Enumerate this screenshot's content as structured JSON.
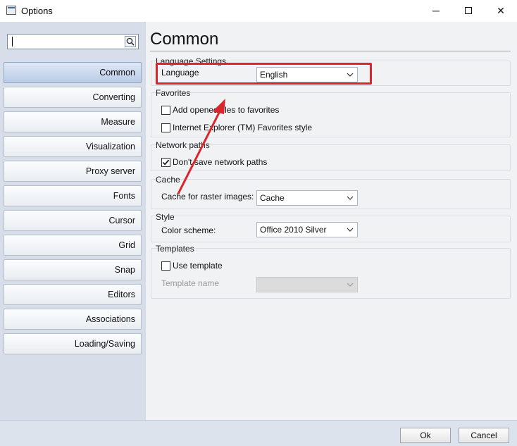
{
  "window": {
    "title": "Options",
    "minimize_glyph": "─",
    "maximize_glyph": "☐",
    "close_glyph": "✕"
  },
  "search": {
    "value": "",
    "icon": "search-icon"
  },
  "nav": {
    "items": [
      {
        "label": "Common",
        "active": true
      },
      {
        "label": "Converting"
      },
      {
        "label": "Measure"
      },
      {
        "label": "Visualization"
      },
      {
        "label": "Proxy server"
      },
      {
        "label": "Fonts"
      },
      {
        "label": "Cursor"
      },
      {
        "label": "Grid"
      },
      {
        "label": "Snap"
      },
      {
        "label": "Editors"
      },
      {
        "label": "Associations"
      },
      {
        "label": "Loading/Saving"
      }
    ]
  },
  "page": {
    "title": "Common"
  },
  "language": {
    "group": "Language Settings",
    "label": "Language",
    "value": "English"
  },
  "favorites": {
    "group": "Favorites",
    "add_opened": {
      "label": "Add opened files to favorites",
      "checked": false
    },
    "ie_style": {
      "label": "Internet Explorer (TM) Favorites style",
      "checked": false
    }
  },
  "network": {
    "group": "Network paths",
    "dont_save": {
      "label": "Don't save network paths",
      "checked": true
    }
  },
  "cache": {
    "group": "Cache",
    "label": "Cache for raster images:",
    "value": "Cache"
  },
  "style": {
    "group": "Style",
    "label": "Color scheme:",
    "value": "Office 2010 Silver"
  },
  "templates": {
    "group": "Templates",
    "use_template": {
      "label": "Use template",
      "checked": false
    },
    "name_label": "Template name",
    "name_value": ""
  },
  "buttons": {
    "ok": "Ok",
    "cancel": "Cancel"
  },
  "colors": {
    "highlight": "#d9262c",
    "active_nav": "#b9cbe6"
  }
}
